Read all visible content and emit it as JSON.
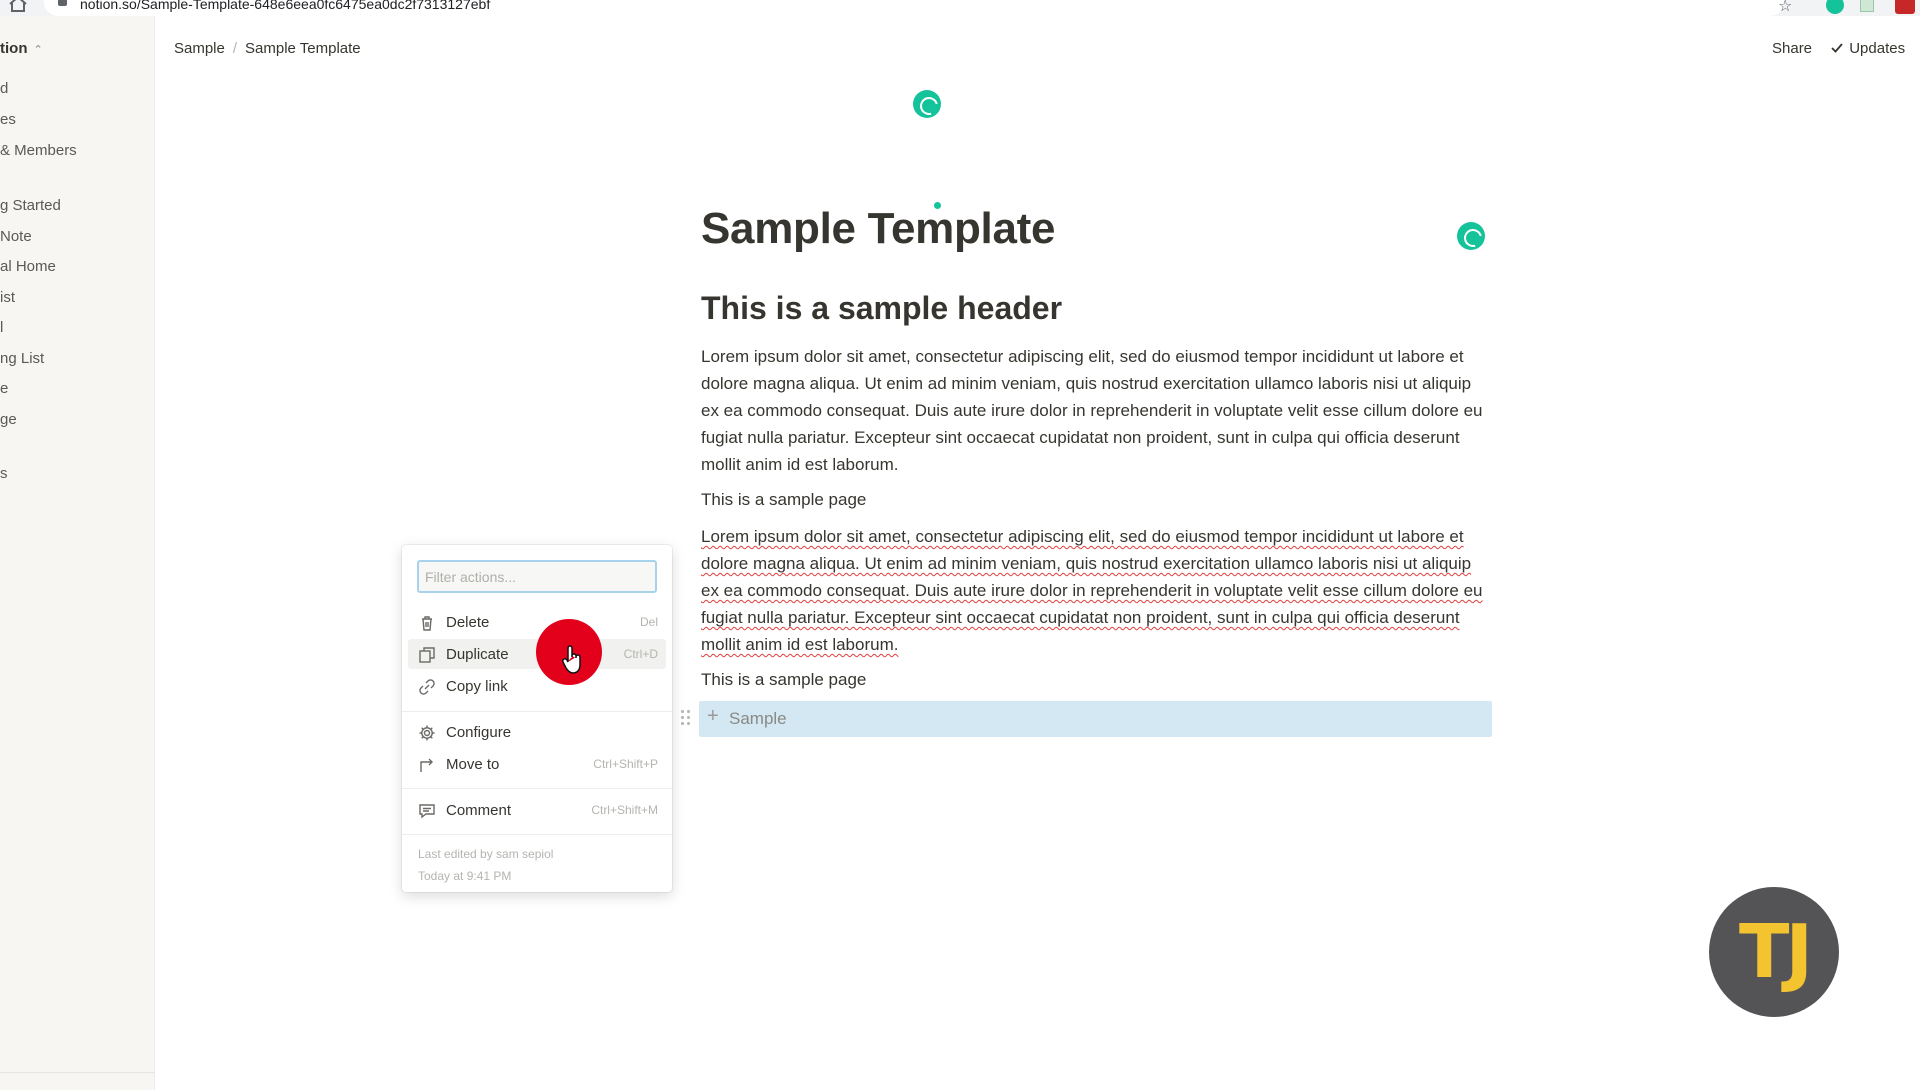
{
  "browser": {
    "url": "notion.so/Sample-Template-648e6eea0fc6475ea0dc2f7313127ebf"
  },
  "sidebar": {
    "workspace_name": "tion",
    "workspace_switch": "⌃",
    "items": [
      {
        "label": "d"
      },
      {
        "label": "es"
      },
      {
        "label": "& Members"
      },
      {
        "label": "g Started"
      },
      {
        "label": "Note"
      },
      {
        "label": "al Home"
      },
      {
        "label": "ist"
      },
      {
        "label": "l"
      },
      {
        "label": "ng List"
      },
      {
        "label": "e"
      },
      {
        "label": "ge"
      },
      {
        "label": "s"
      }
    ]
  },
  "topbar": {
    "breadcrumb": [
      "Sample",
      "Sample Template"
    ],
    "breadcrumb_separator": "/",
    "share_label": "Share",
    "updates_label": "Updates"
  },
  "page": {
    "title": "Sample Template",
    "header": "This is a sample header",
    "paragraph1": "Lorem ipsum dolor sit amet, consectetur adipiscing elit, sed do eiusmod tempor incididunt ut labore et dolore magna aliqua. Ut enim ad minim veniam, quis nostrud exercitation ullamco laboris nisi ut aliquip ex ea commodo consequat. Duis aute irure dolor in reprehenderit in voluptate velit esse cillum dolore eu fugiat nulla pariatur. Excepteur sint occaecat cupidatat non proident, sunt in culpa qui officia deserunt mollit anim id est laborum.",
    "page_link1": "This is a sample page",
    "paragraph2": "Lorem ipsum dolor sit amet, consectetur adipiscing elit, sed do eiusmod tempor incididunt ut labore et dolore magna aliqua. Ut enim ad minim veniam, quis nostrud exercitation ullamco laboris nisi ut aliquip ex ea commodo consequat. Duis aute irure dolor in reprehenderit in voluptate velit esse cillum dolore eu fugiat nulla pariatur. Excepteur sint occaecat cupidatat non proident, sunt in culpa qui officia deserunt mollit anim id est laborum.",
    "page_link2": "This is a sample page",
    "selected_block_label": "Sample"
  },
  "context_menu": {
    "filter_placeholder": "Filter actions...",
    "items": [
      {
        "label": "Delete",
        "shortcut": "Del",
        "icon": "trash-icon"
      },
      {
        "label": "Duplicate",
        "shortcut": "Ctrl+D",
        "icon": "duplicate-icon"
      },
      {
        "label": "Copy link",
        "shortcut": "",
        "icon": "link-icon"
      },
      {
        "label": "Configure",
        "shortcut": "",
        "icon": "gear-icon"
      },
      {
        "label": "Move to",
        "shortcut": "Ctrl+Shift+P",
        "icon": "move-arrow-icon"
      },
      {
        "label": "Comment",
        "shortcut": "Ctrl+Shift+M",
        "icon": "comment-icon"
      }
    ],
    "footer_line1": "Last edited by sam sepiol",
    "footer_line2": "Today at 9:41 PM"
  },
  "watermark": {
    "text": "TJ"
  },
  "colors": {
    "accent_green": "#15c39a",
    "selection_blue": "#d3e8f2",
    "click_highlight": "#e3001b",
    "logo_yellow": "#f4c430",
    "logo_gray": "#545457"
  }
}
